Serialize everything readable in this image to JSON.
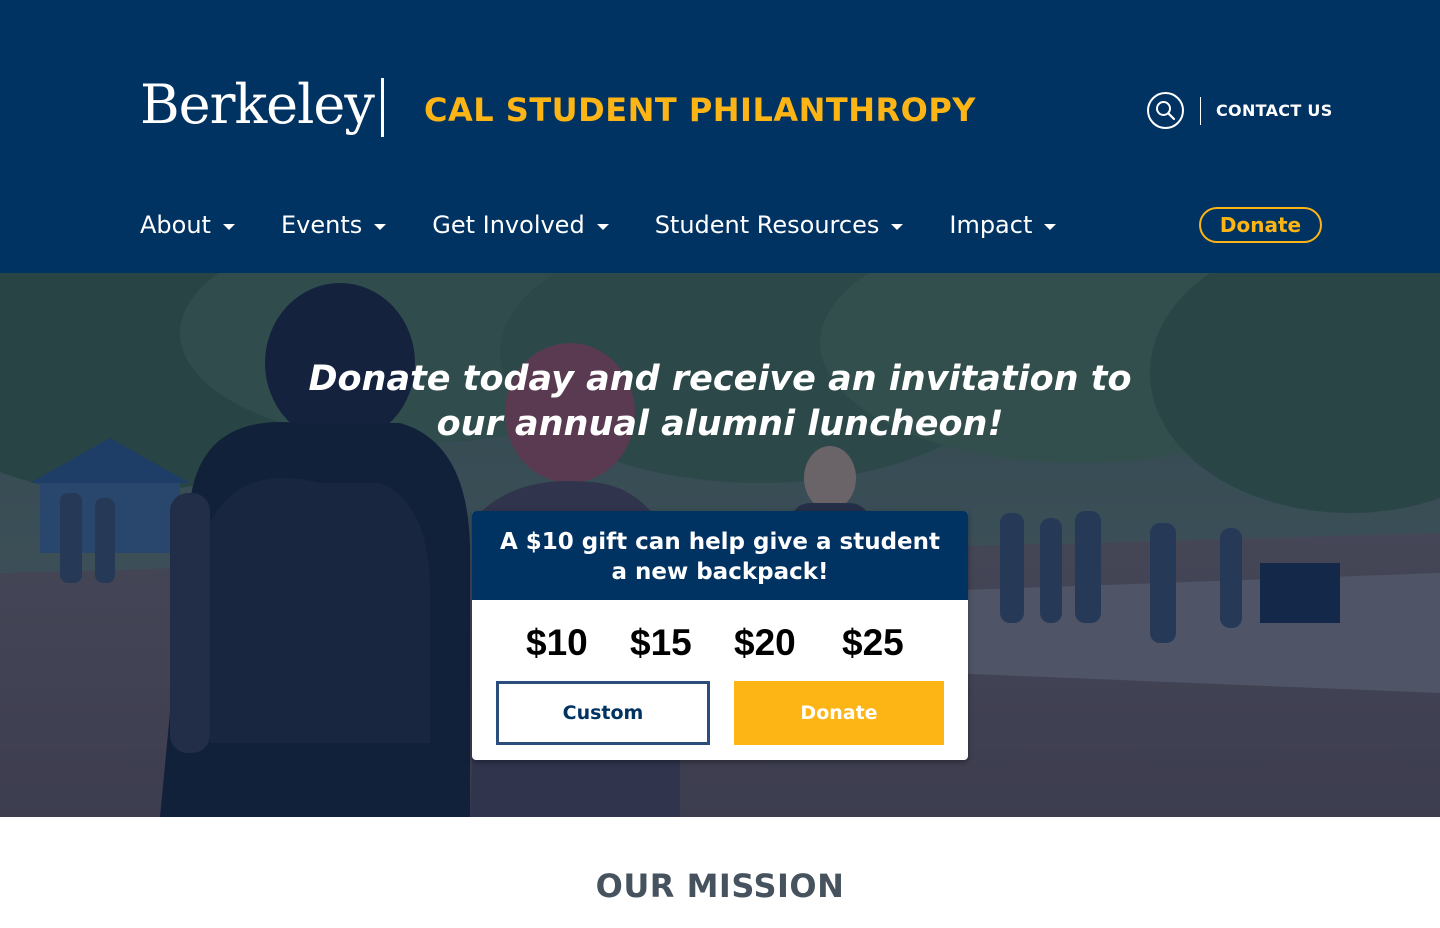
{
  "colors": {
    "primary_blue": "#003262",
    "gold": "#FDB515",
    "mission_text": "#46535e",
    "button_border": "#2c4e7c"
  },
  "header": {
    "logo_text": "Berkeley",
    "site_title": "CAL STUDENT PHILANTHROPY",
    "search_icon": "search-icon",
    "contact_label": "CONTACT US",
    "nav": [
      {
        "label": "About"
      },
      {
        "label": "Events"
      },
      {
        "label": "Get Involved"
      },
      {
        "label": "Student Resources"
      },
      {
        "label": "Impact"
      }
    ],
    "donate_label": "Donate"
  },
  "hero": {
    "headline": "Donate today and receive an invitation to our annual alumni luncheon!",
    "card": {
      "heading": "A $10 gift can help give a student a new backpack!",
      "amounts": [
        "$10",
        "$15",
        "$20",
        "$25"
      ],
      "custom_label": "Custom",
      "donate_label": "Donate"
    }
  },
  "mission": {
    "title": "OUR MISSION"
  }
}
